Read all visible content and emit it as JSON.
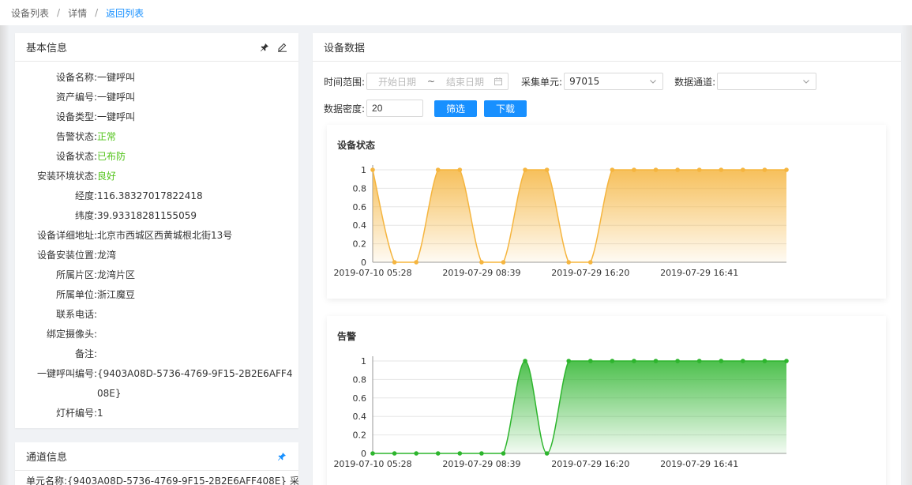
{
  "breadcrumb": {
    "items": [
      "设备列表",
      "详情"
    ],
    "back_link": "返回列表"
  },
  "basic_info": {
    "title": "基本信息",
    "rows": [
      {
        "label": "设备名称:",
        "value": "一键呼叫"
      },
      {
        "label": "资产编号:",
        "value": "一键呼叫"
      },
      {
        "label": "设备类型:",
        "value": "一键呼叫"
      },
      {
        "label": "告警状态:",
        "value": "正常"
      },
      {
        "label": "设备状态:",
        "value": "已布防"
      },
      {
        "label": "安装环境状态:",
        "value": "良好"
      },
      {
        "label": "经度:",
        "value": "116.38327017822418"
      },
      {
        "label": "纬度:",
        "value": "39.93318281155059"
      },
      {
        "label": "设备详细地址:",
        "value": "北京市西城区西黄城根北街13号"
      },
      {
        "label": "设备安装位置:",
        "value": "龙湾"
      },
      {
        "label": "所属片区:",
        "value": "龙湾片区"
      },
      {
        "label": "所属单位:",
        "value": "浙江魔豆"
      },
      {
        "label": "联系电话:",
        "value": ""
      },
      {
        "label": "绑定摄像头:",
        "value": ""
      },
      {
        "label": "备注:",
        "value": ""
      },
      {
        "label": "一键呼叫编号:",
        "value": "{9403A08D-5736-4769-9F15-2B2E6AFF408E}"
      },
      {
        "label": "灯杆编号:",
        "value": "1"
      }
    ],
    "status_color": "#52c41a"
  },
  "channel_info": {
    "title": "通道信息",
    "unit_label": "单元名称:",
    "unit_value": "{9403A08D-5736-4769-9F15-2B2E6AFF408E}",
    "unit_suffix": "采"
  },
  "device_data": {
    "title": "设备数据",
    "time_range_label": "时间范围:",
    "start_placeholder": "开始日期",
    "range_separator": "~",
    "end_placeholder": "结束日期",
    "unit_label": "采集单元:",
    "unit_value": "97015",
    "channel_label": "数据通道:",
    "channel_value": "",
    "density_label": "数据密度:",
    "density_value": "20",
    "filter_button": "筛选",
    "download_button": "下载",
    "accent_color": "#1890ff"
  },
  "chart_data": [
    {
      "type": "area",
      "title": "设备状态",
      "color": "#f5b53f",
      "ylim": [
        0,
        1
      ],
      "y_ticks": [
        "0",
        "0.2",
        "0.4",
        "0.6",
        "0.8",
        "1"
      ],
      "x_tick_labels": [
        "2019-07-10 05:28",
        "2019-07-29 08:39",
        "2019-07-29 16:20",
        "2019-07-29 16:41"
      ],
      "values": [
        1,
        0,
        0,
        1,
        1,
        0,
        0,
        1,
        1,
        0,
        0,
        1,
        1,
        1,
        1,
        1,
        1,
        1,
        1,
        1
      ]
    },
    {
      "type": "area",
      "title": "告警",
      "color": "#2db52d",
      "ylim": [
        0,
        1
      ],
      "y_ticks": [
        "0",
        "0.2",
        "0.4",
        "0.6",
        "0.8",
        "1"
      ],
      "x_tick_labels": [
        "2019-07-10 05:28",
        "2019-07-29 08:39",
        "2019-07-29 16:20",
        "2019-07-29 16:41"
      ],
      "values": [
        0,
        0,
        0,
        0,
        0,
        0,
        0,
        1,
        0,
        1,
        1,
        1,
        1,
        1,
        1,
        1,
        1,
        1,
        1,
        1
      ]
    }
  ]
}
